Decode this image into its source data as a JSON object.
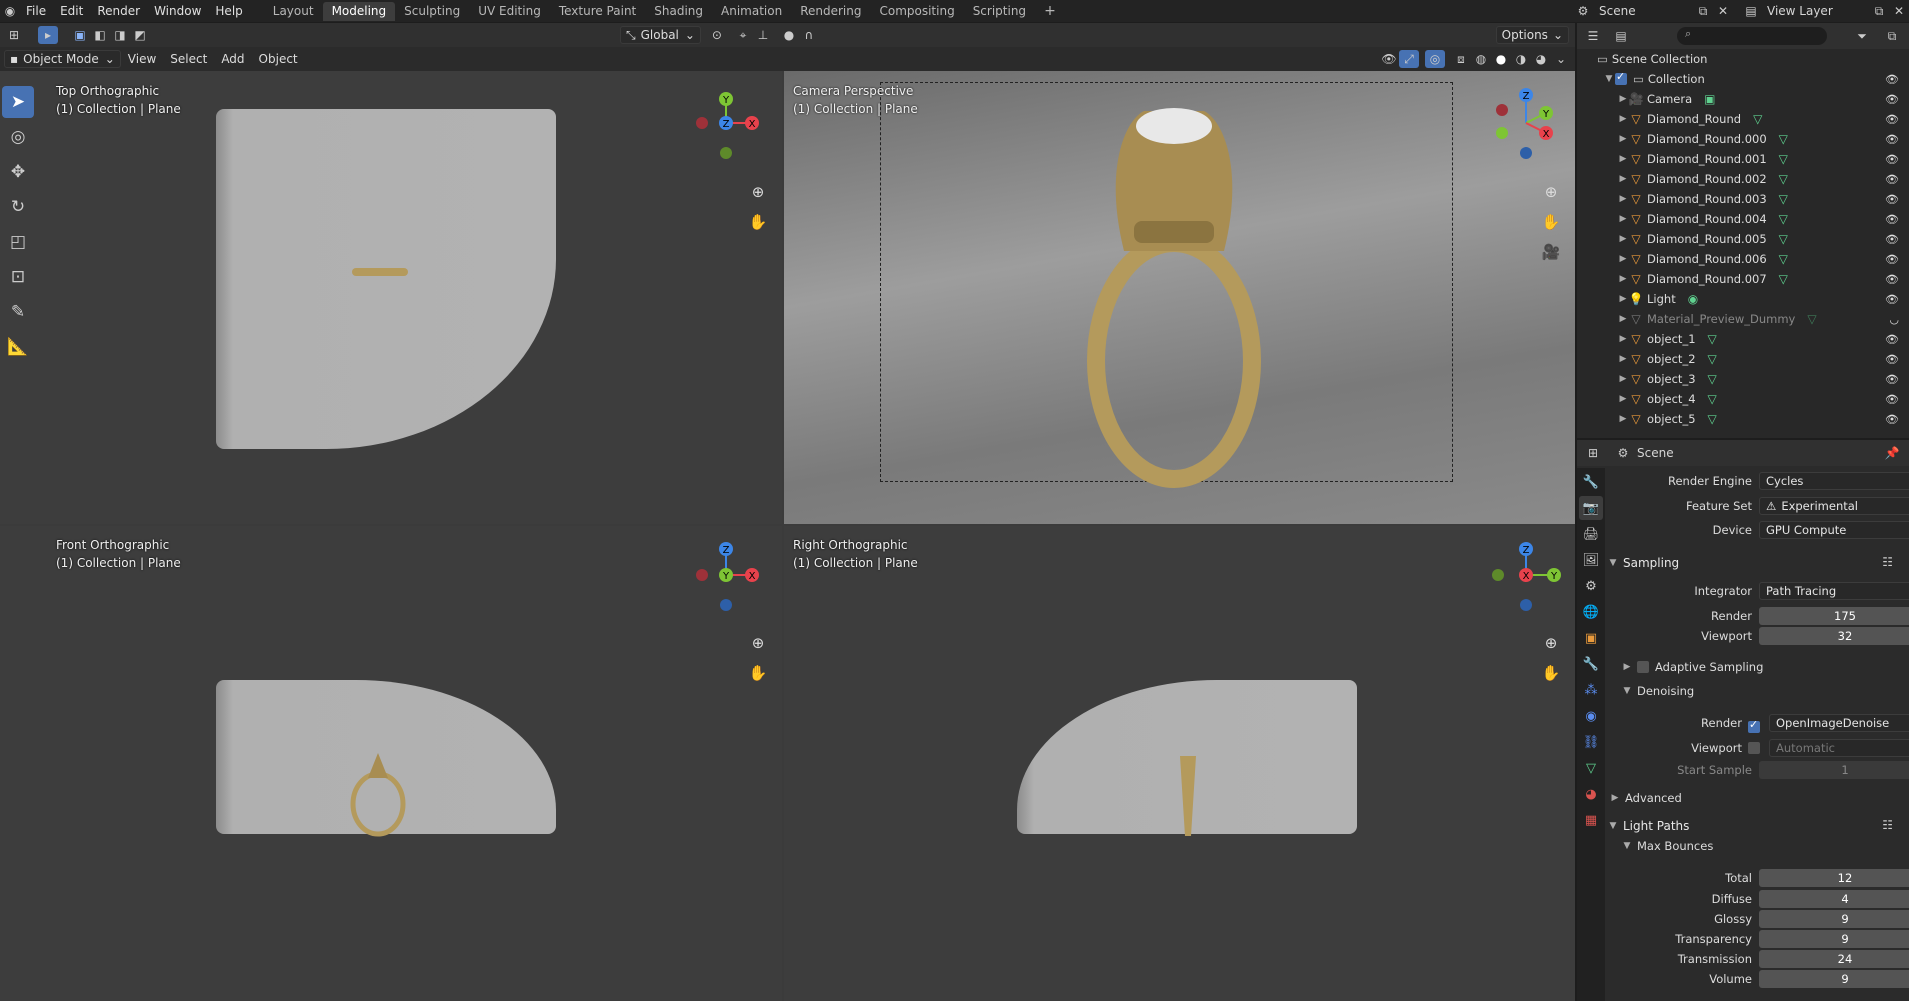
{
  "menu": {
    "items": [
      "File",
      "Edit",
      "Render",
      "Window",
      "Help"
    ]
  },
  "workspaces": {
    "tabs": [
      "Layout",
      "Modeling",
      "Sculpting",
      "UV Editing",
      "Texture Paint",
      "Shading",
      "Animation",
      "Rendering",
      "Compositing",
      "Scripting"
    ],
    "active": "Modeling",
    "add": "+"
  },
  "scene": {
    "name": "Scene",
    "view_layer": "View Layer"
  },
  "vp_header": {
    "mode": "Object Mode",
    "view": "View",
    "select": "Select",
    "add": "Add",
    "object": "Object",
    "transform": "Global",
    "options": "Options"
  },
  "viewports": [
    {
      "title": "Top Orthographic",
      "subtitle": "(1) Collection | Plane"
    },
    {
      "title": "Camera Perspective",
      "subtitle": "(1) Collection | Plane"
    },
    {
      "title": "Front Orthographic",
      "subtitle": "(1) Collection | Plane"
    },
    {
      "title": "Right Orthographic",
      "subtitle": "(1) Collection | Plane"
    }
  ],
  "gizmo_axes": {
    "x": "X",
    "y": "Y",
    "z": "Z"
  },
  "outliner": {
    "search_placeholder": "",
    "root": "Scene Collection",
    "collection": "Collection",
    "items": [
      {
        "name": "Camera",
        "type": "camera"
      },
      {
        "name": "Diamond_Round",
        "type": "mesh"
      },
      {
        "name": "Diamond_Round.000",
        "type": "mesh"
      },
      {
        "name": "Diamond_Round.001",
        "type": "mesh"
      },
      {
        "name": "Diamond_Round.002",
        "type": "mesh"
      },
      {
        "name": "Diamond_Round.003",
        "type": "mesh"
      },
      {
        "name": "Diamond_Round.004",
        "type": "mesh"
      },
      {
        "name": "Diamond_Round.005",
        "type": "mesh"
      },
      {
        "name": "Diamond_Round.006",
        "type": "mesh"
      },
      {
        "name": "Diamond_Round.007",
        "type": "mesh"
      },
      {
        "name": "Light",
        "type": "light"
      },
      {
        "name": "Material_Preview_Dummy",
        "type": "mesh_hidden"
      },
      {
        "name": "object_1",
        "type": "mesh"
      },
      {
        "name": "object_2",
        "type": "mesh"
      },
      {
        "name": "object_3",
        "type": "mesh"
      },
      {
        "name": "object_4",
        "type": "mesh"
      },
      {
        "name": "object_5",
        "type": "mesh"
      }
    ]
  },
  "properties": {
    "context": "Scene",
    "render_engine_label": "Render Engine",
    "render_engine": "Cycles",
    "feature_set_label": "Feature Set",
    "feature_set": "Experimental",
    "device_label": "Device",
    "device": "GPU Compute",
    "sampling": {
      "title": "Sampling",
      "integrator_label": "Integrator",
      "integrator": "Path Tracing",
      "render_label": "Render",
      "render": "175",
      "viewport_label": "Viewport",
      "viewport": "32"
    },
    "adaptive_sampling": "Adaptive Sampling",
    "denoising": {
      "title": "Denoising",
      "render_label": "Render",
      "render": "OpenImageDenoise",
      "viewport_label": "Viewport",
      "viewport": "Automatic",
      "start_sample_label": "Start Sample",
      "start_sample": "1"
    },
    "advanced": "Advanced",
    "light_paths": {
      "title": "Light Paths",
      "max_bounces": "Max Bounces",
      "rows": [
        {
          "label": "Total",
          "value": "12"
        },
        {
          "label": "Diffuse",
          "value": "4"
        },
        {
          "label": "Glossy",
          "value": "9"
        },
        {
          "label": "Transparency",
          "value": "9"
        },
        {
          "label": "Transmission",
          "value": "24"
        },
        {
          "label": "Volume",
          "value": "9"
        }
      ]
    }
  },
  "colors": {
    "accent": "#4772b3",
    "axis_x": "#e8424c",
    "axis_y": "#7ec534",
    "axis_z": "#3c86e8",
    "mesh_icon": "#5fd18f",
    "object_icon": "#e99a3c",
    "ring_gold": "#b49a5c"
  }
}
